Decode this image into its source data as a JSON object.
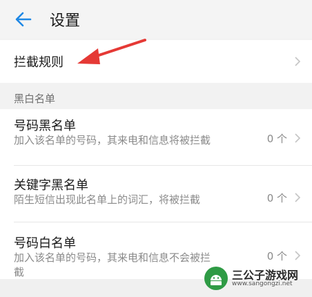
{
  "header": {
    "title": "设置"
  },
  "intercept_rules": {
    "label": "拦截规则"
  },
  "section": {
    "label": "黑白名单"
  },
  "items": [
    {
      "title": "号码黑名单",
      "desc": "加入该名单的号码，其来电和信息将被拦截",
      "count": "0 个"
    },
    {
      "title": "关键字黑名单",
      "desc": "陌生短信出现此名单上的词汇，将被拦截",
      "count": "0 个"
    },
    {
      "title": "号码白名单",
      "desc": "加入该名单的号码，其来电和信息不会被拦截",
      "count": "0 个"
    }
  ],
  "watermark": {
    "name": "三公子游戏网",
    "url": "www.sangongzi.net"
  },
  "colors": {
    "accent": "#1e88e5",
    "annotation": "#e53935"
  }
}
